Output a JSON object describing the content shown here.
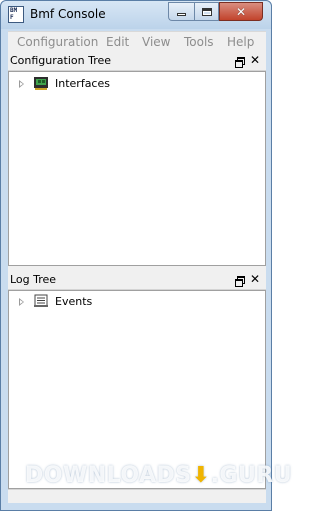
{
  "window": {
    "title": "Bmf Console",
    "icon": "bmf-app-icon"
  },
  "menu": [
    "Configuration",
    "Edit",
    "View",
    "Tools",
    "Help"
  ],
  "config_pane": {
    "title": "Configuration Tree",
    "nodes": [
      {
        "label": "Interfaces",
        "icon": "network-card-icon"
      }
    ]
  },
  "log_pane": {
    "title": "Log Tree",
    "nodes": [
      {
        "label": "Events",
        "icon": "events-log-icon"
      }
    ]
  },
  "watermark": {
    "text_left": "DOWNLOADS",
    "text_right": ".GURU"
  },
  "colors": {
    "accent": "#c9dcef",
    "close_button": "#c2432c",
    "watermark_arrow": "#f0b400"
  }
}
